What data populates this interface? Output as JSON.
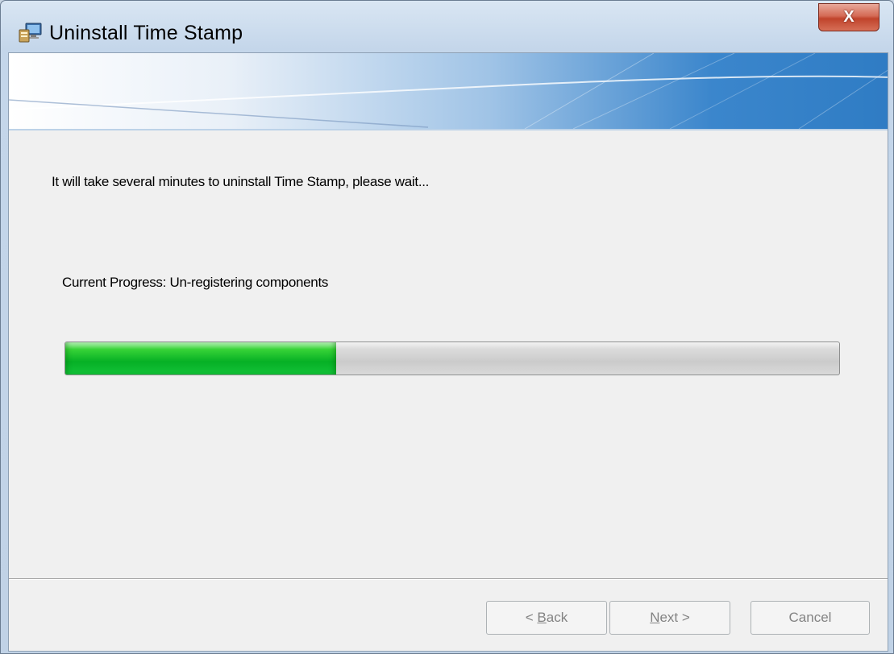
{
  "window": {
    "title": "Uninstall Time Stamp",
    "close_glyph": "X"
  },
  "main": {
    "message": "It will take several minutes to uninstall Time Stamp, please wait...",
    "progress_label": "Current Progress: Un-registering components",
    "progress_fraction": 0.35
  },
  "buttons": {
    "back": {
      "prefix": "< ",
      "mnemonic": "B",
      "rest": "ack"
    },
    "next": {
      "mnemonic": "N",
      "rest": "ext",
      "suffix": " >"
    },
    "cancel": "Cancel"
  },
  "colors": {
    "progress_fill": "#06b025",
    "dialog_bg": "#f0f0f0",
    "close_button": "#c0432b"
  },
  "icons": {
    "title_icon": "installer-computer-icon",
    "close_icon": "close-icon"
  }
}
